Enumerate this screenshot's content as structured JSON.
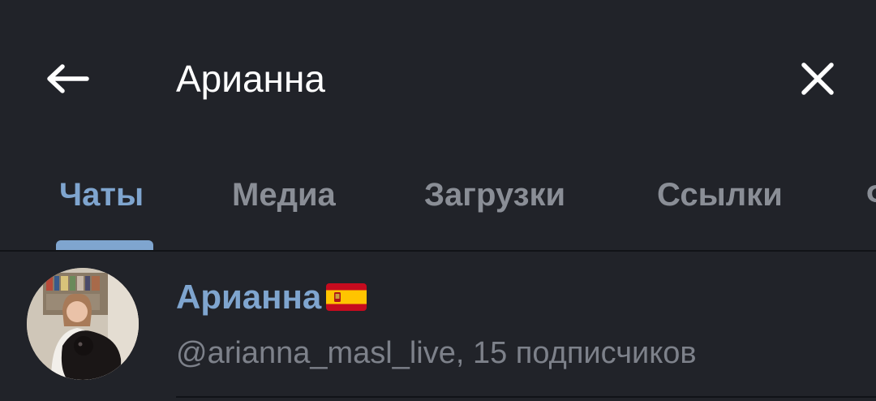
{
  "search": {
    "value": "Арианна",
    "back_icon": "arrow-left-icon",
    "clear_icon": "close-icon"
  },
  "tabs": [
    {
      "label": "Чаты",
      "active": true
    },
    {
      "label": "Медиа",
      "active": false
    },
    {
      "label": "Загрузки",
      "active": false
    },
    {
      "label": "Ссылки",
      "active": false
    },
    {
      "label": "Ф",
      "active": false
    }
  ],
  "results": [
    {
      "name": "Арианна",
      "flag_icon": "spain-flag-icon",
      "subtitle": "@arianna_masl_live, 15 подписчиков"
    }
  ],
  "colors": {
    "background": "#212329",
    "accent": "#7fa5cf",
    "tab_inactive": "#8a8e96",
    "subtitle": "#7d818a",
    "text": "#ffffff"
  }
}
